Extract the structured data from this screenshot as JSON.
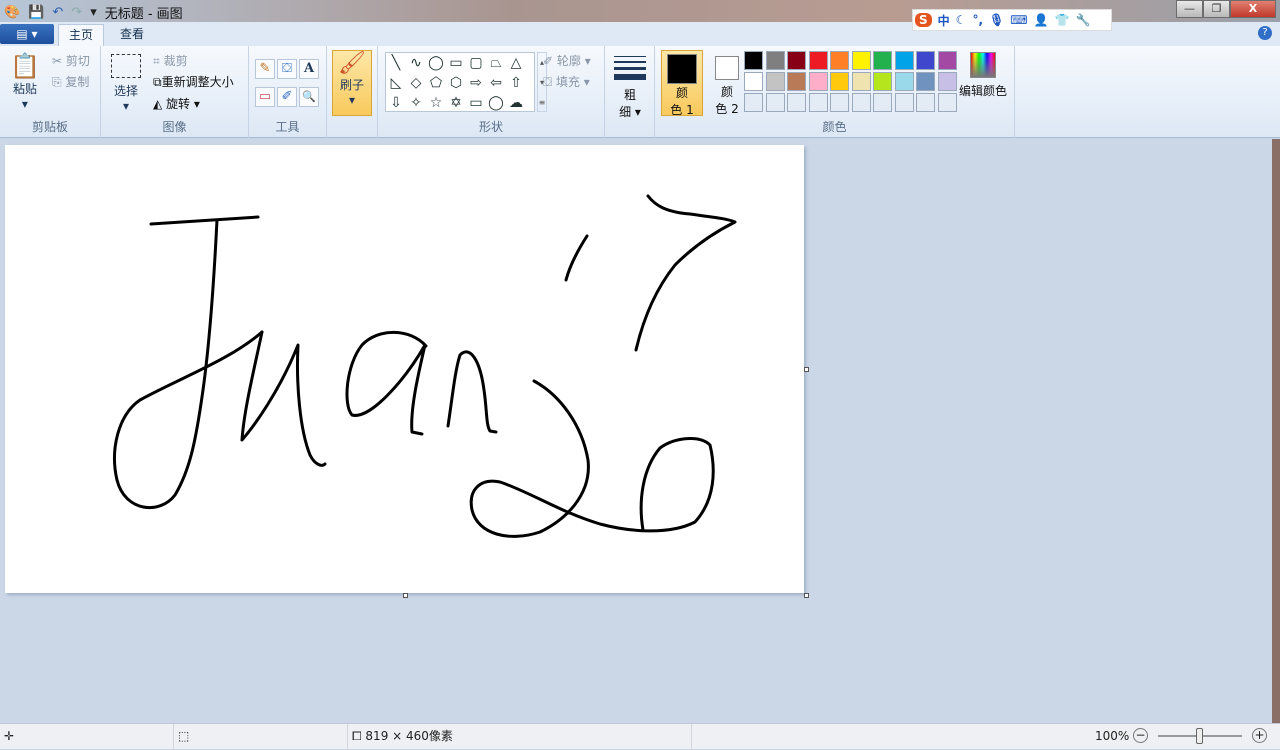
{
  "titlebar": {
    "title": "无标题 - 画图",
    "quick_access": [
      "save-icon",
      "undo-icon",
      "redo-icon",
      "customize-icon"
    ]
  },
  "ime": {
    "logo": "S",
    "mode": "中",
    "items": [
      "moon-icon",
      "punct-icon",
      "mic-icon",
      "keyboard-icon",
      "user-icon",
      "shirt-icon",
      "wrench-icon"
    ],
    "punct": "°,"
  },
  "window": {
    "minimize": "—",
    "restore": "❐",
    "close": "X"
  },
  "tabs": {
    "app_menu": "▤ ▾",
    "home": "主页",
    "view": "查看",
    "help": "?"
  },
  "clipboard": {
    "paste": "粘贴",
    "cut": "剪切",
    "copy": "复制",
    "label": "剪贴板"
  },
  "image": {
    "select": "选择",
    "crop": "裁剪",
    "resize": "重新调整大小",
    "rotate": "旋转 ▾",
    "label": "图像"
  },
  "tools": {
    "label": "工具",
    "items": [
      "✎",
      "⛋",
      "A",
      "▭",
      "✐",
      "🔍"
    ]
  },
  "brush": {
    "label": "刷子"
  },
  "shapes": {
    "label": "形状",
    "items": [
      "╲",
      "∿",
      "◯",
      "▭",
      "▢",
      "⏢",
      "△",
      "◺",
      "◇",
      "⬠",
      "⬡",
      "⇨",
      "⇦",
      "⇧",
      "⇩",
      "✧",
      "☆",
      "✡",
      "▭",
      "◯",
      "☁"
    ],
    "outline": "轮廓 ▾",
    "fill": "填充 ▾"
  },
  "size": {
    "label_1": "粗",
    "label_2": "细 ▾"
  },
  "colors": {
    "color1_a": "颜",
    "color1_b": "色 1",
    "color2_a": "颜",
    "color2_b": "色 2",
    "label": "颜色",
    "edit": "编辑颜色",
    "color1": "#000000",
    "color2": "#ffffff",
    "palette": [
      "#000000",
      "#7f7f7f",
      "#880015",
      "#ed1c24",
      "#ff7f27",
      "#fff200",
      "#22b14c",
      "#00a2e8",
      "#3f48cc",
      "#a349a4",
      "#ffffff",
      "#c3c3c3",
      "#b97a57",
      "#ffaec9",
      "#ffc90e",
      "#efe4b0",
      "#b5e61d",
      "#99d9ea",
      "#7092be",
      "#c8bfe7"
    ]
  },
  "status": {
    "dimensions": "819 × 460像素",
    "zoom": "100%",
    "zoom_out": "−",
    "zoom_in": "+"
  }
}
